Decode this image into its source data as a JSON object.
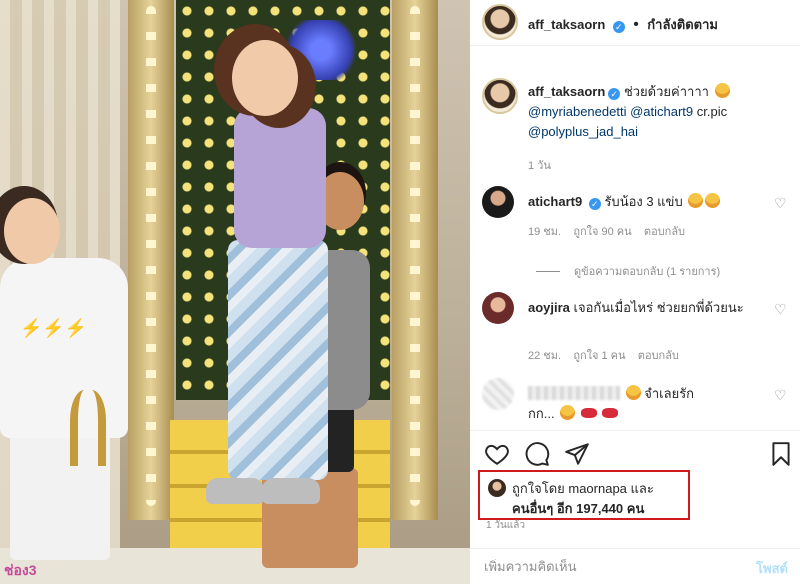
{
  "header": {
    "username": "aff_taksaorn",
    "separator": "•",
    "follow_status": "กำลังติดตาม"
  },
  "caption": {
    "username": "aff_taksaorn",
    "text": "ช่วยด้วยค่าาาา",
    "mentions": [
      "@myriabenedetti",
      "@atichart9",
      "@polyplus_jad_hai"
    ],
    "suffix": "cr.pic",
    "time": "1 วัน"
  },
  "comments": [
    {
      "username": "atichart9",
      "text": "รับน้อง 3 แข่บ",
      "time": "19 ชม.",
      "likes": "ถูกใจ 90 คน",
      "reply_label": "ตอบกลับ",
      "view_replies": "ดูข้อความตอบกลับ (1 รายการ)"
    },
    {
      "username": "aoyjira",
      "text": "เจอกันเมื่อไหร่ ช่วยยกพี่ด้วยนะ",
      "time": "22 ชม.",
      "likes": "ถูกใจ 1 คน",
      "reply_label": "ตอบกลับ"
    },
    {
      "username": "",
      "text": "จำเลยรัก",
      "text2": "กก..."
    }
  ],
  "likes": {
    "line1": "ถูกใจโดย maornapa และ",
    "line2": "คนอื่นๆ อีก 197,440 คน"
  },
  "post_time": "1 วันแล้ว",
  "comment_box": {
    "placeholder": "เพิ่มความคิดเห็น",
    "post_label": "โพสต์"
  },
  "icons": {
    "verified": "verified-badge-icon",
    "heart": "heart-icon",
    "comment": "comment-icon",
    "share": "share-icon",
    "save": "bookmark-icon"
  },
  "colors": {
    "verified": "#3897f0",
    "highlight_box": "#d11a1a",
    "mention": "#00376b",
    "post_button": "#b2dffc"
  },
  "photo": {
    "watermark": "ช่อง3"
  }
}
